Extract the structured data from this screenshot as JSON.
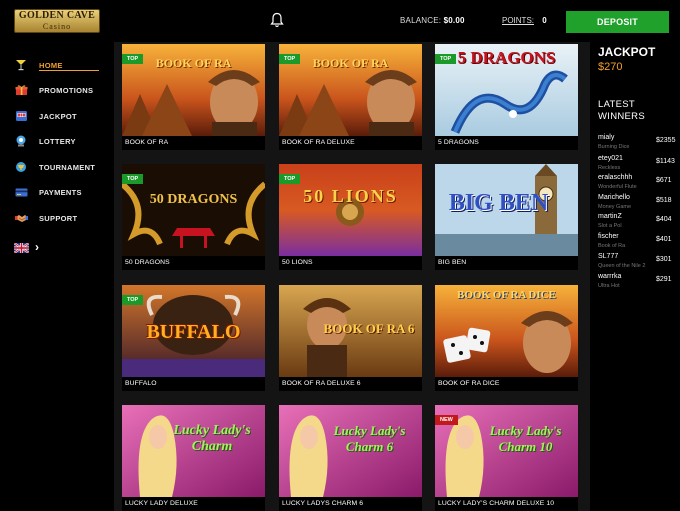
{
  "header": {
    "logo_line1": "GOLDEN CAVE",
    "logo_line2": "Casino",
    "balance_label": "BALANCE:",
    "balance_value": "$0.00",
    "points_label": "POINTS:",
    "points_value": "0",
    "deposit_label": "DEPOSIT"
  },
  "sidebar": {
    "items": [
      {
        "label": "HOME",
        "icon": "cocktail-icon"
      },
      {
        "label": "PROMOTIONS",
        "icon": "gift-icon"
      },
      {
        "label": "JACKPOT",
        "icon": "slot-machine-icon"
      },
      {
        "label": "LOTTERY",
        "icon": "lottery-ball-icon"
      },
      {
        "label": "TOURNAMENT",
        "icon": "trophy-icon"
      },
      {
        "label": "PAYMENTS",
        "icon": "credit-card-icon"
      },
      {
        "label": "SUPPORT",
        "icon": "handshake-icon"
      }
    ],
    "language_icon": "uk-flag-icon"
  },
  "games": [
    {
      "label": "BOOK OF RA",
      "badge": "TOP",
      "art": "BOOK OF RA"
    },
    {
      "label": "BOOK OF RA DELUXE",
      "badge": "TOP",
      "art": "BOOK OF RA"
    },
    {
      "label": "5 DRAGONS",
      "badge": "TOP",
      "art": "5 DRAGONS"
    },
    {
      "label": "50 DRAGONS",
      "badge": "TOP",
      "art": "50 DRAGONS"
    },
    {
      "label": "50 LIONS",
      "badge": "TOP",
      "art": "50 LIONS"
    },
    {
      "label": "BIG BEN",
      "badge": "",
      "art": "BIG BEN"
    },
    {
      "label": "BUFFALO",
      "badge": "TOP",
      "art": "BUFFALO"
    },
    {
      "label": "BOOK OF RA DELUXE 6",
      "badge": "",
      "art": "BOOK OF RA 6"
    },
    {
      "label": "BOOK OF RA DICE",
      "badge": "",
      "art": "BOOK OF RA DICE"
    },
    {
      "label": "LUCKY LADY DELUXE",
      "badge": "",
      "art": "Lucky Lady's Charm"
    },
    {
      "label": "LUCKY LADYS CHARM 6",
      "badge": "",
      "art": "Lucky Lady's Charm 6"
    },
    {
      "label": "LUCKY LADY'S CHARM DELUXE 10",
      "badge": "NEW",
      "art": "Lucky Lady's Charm 10"
    }
  ],
  "jackpot": {
    "title": "JACKPOT",
    "value": "$270"
  },
  "latest_winners": {
    "title": "LATEST WINNERS",
    "items": [
      {
        "name": "mialy",
        "game": "Burning Dice",
        "amount": "$2355"
      },
      {
        "name": "etey021",
        "game": "Reckless",
        "amount": "$1143"
      },
      {
        "name": "eralaschhh",
        "game": "Wonderful Flute",
        "amount": "$671"
      },
      {
        "name": "Marichello",
        "game": "Money Game",
        "amount": "$518"
      },
      {
        "name": "martinZ",
        "game": "Slot a Pol",
        "amount": "$404"
      },
      {
        "name": "fischer",
        "game": "Book of Ra",
        "amount": "$401"
      },
      {
        "name": "SL777",
        "game": "Queen of the Nile 2",
        "amount": "$301"
      },
      {
        "name": "warrrka",
        "game": "Ultra Hot",
        "amount": "$291"
      }
    ]
  },
  "colors": {
    "accent": "#f0a02a",
    "deposit_green": "#1fa12b",
    "badge_top": "#1b9a29",
    "badge_new": "#c2191d"
  }
}
